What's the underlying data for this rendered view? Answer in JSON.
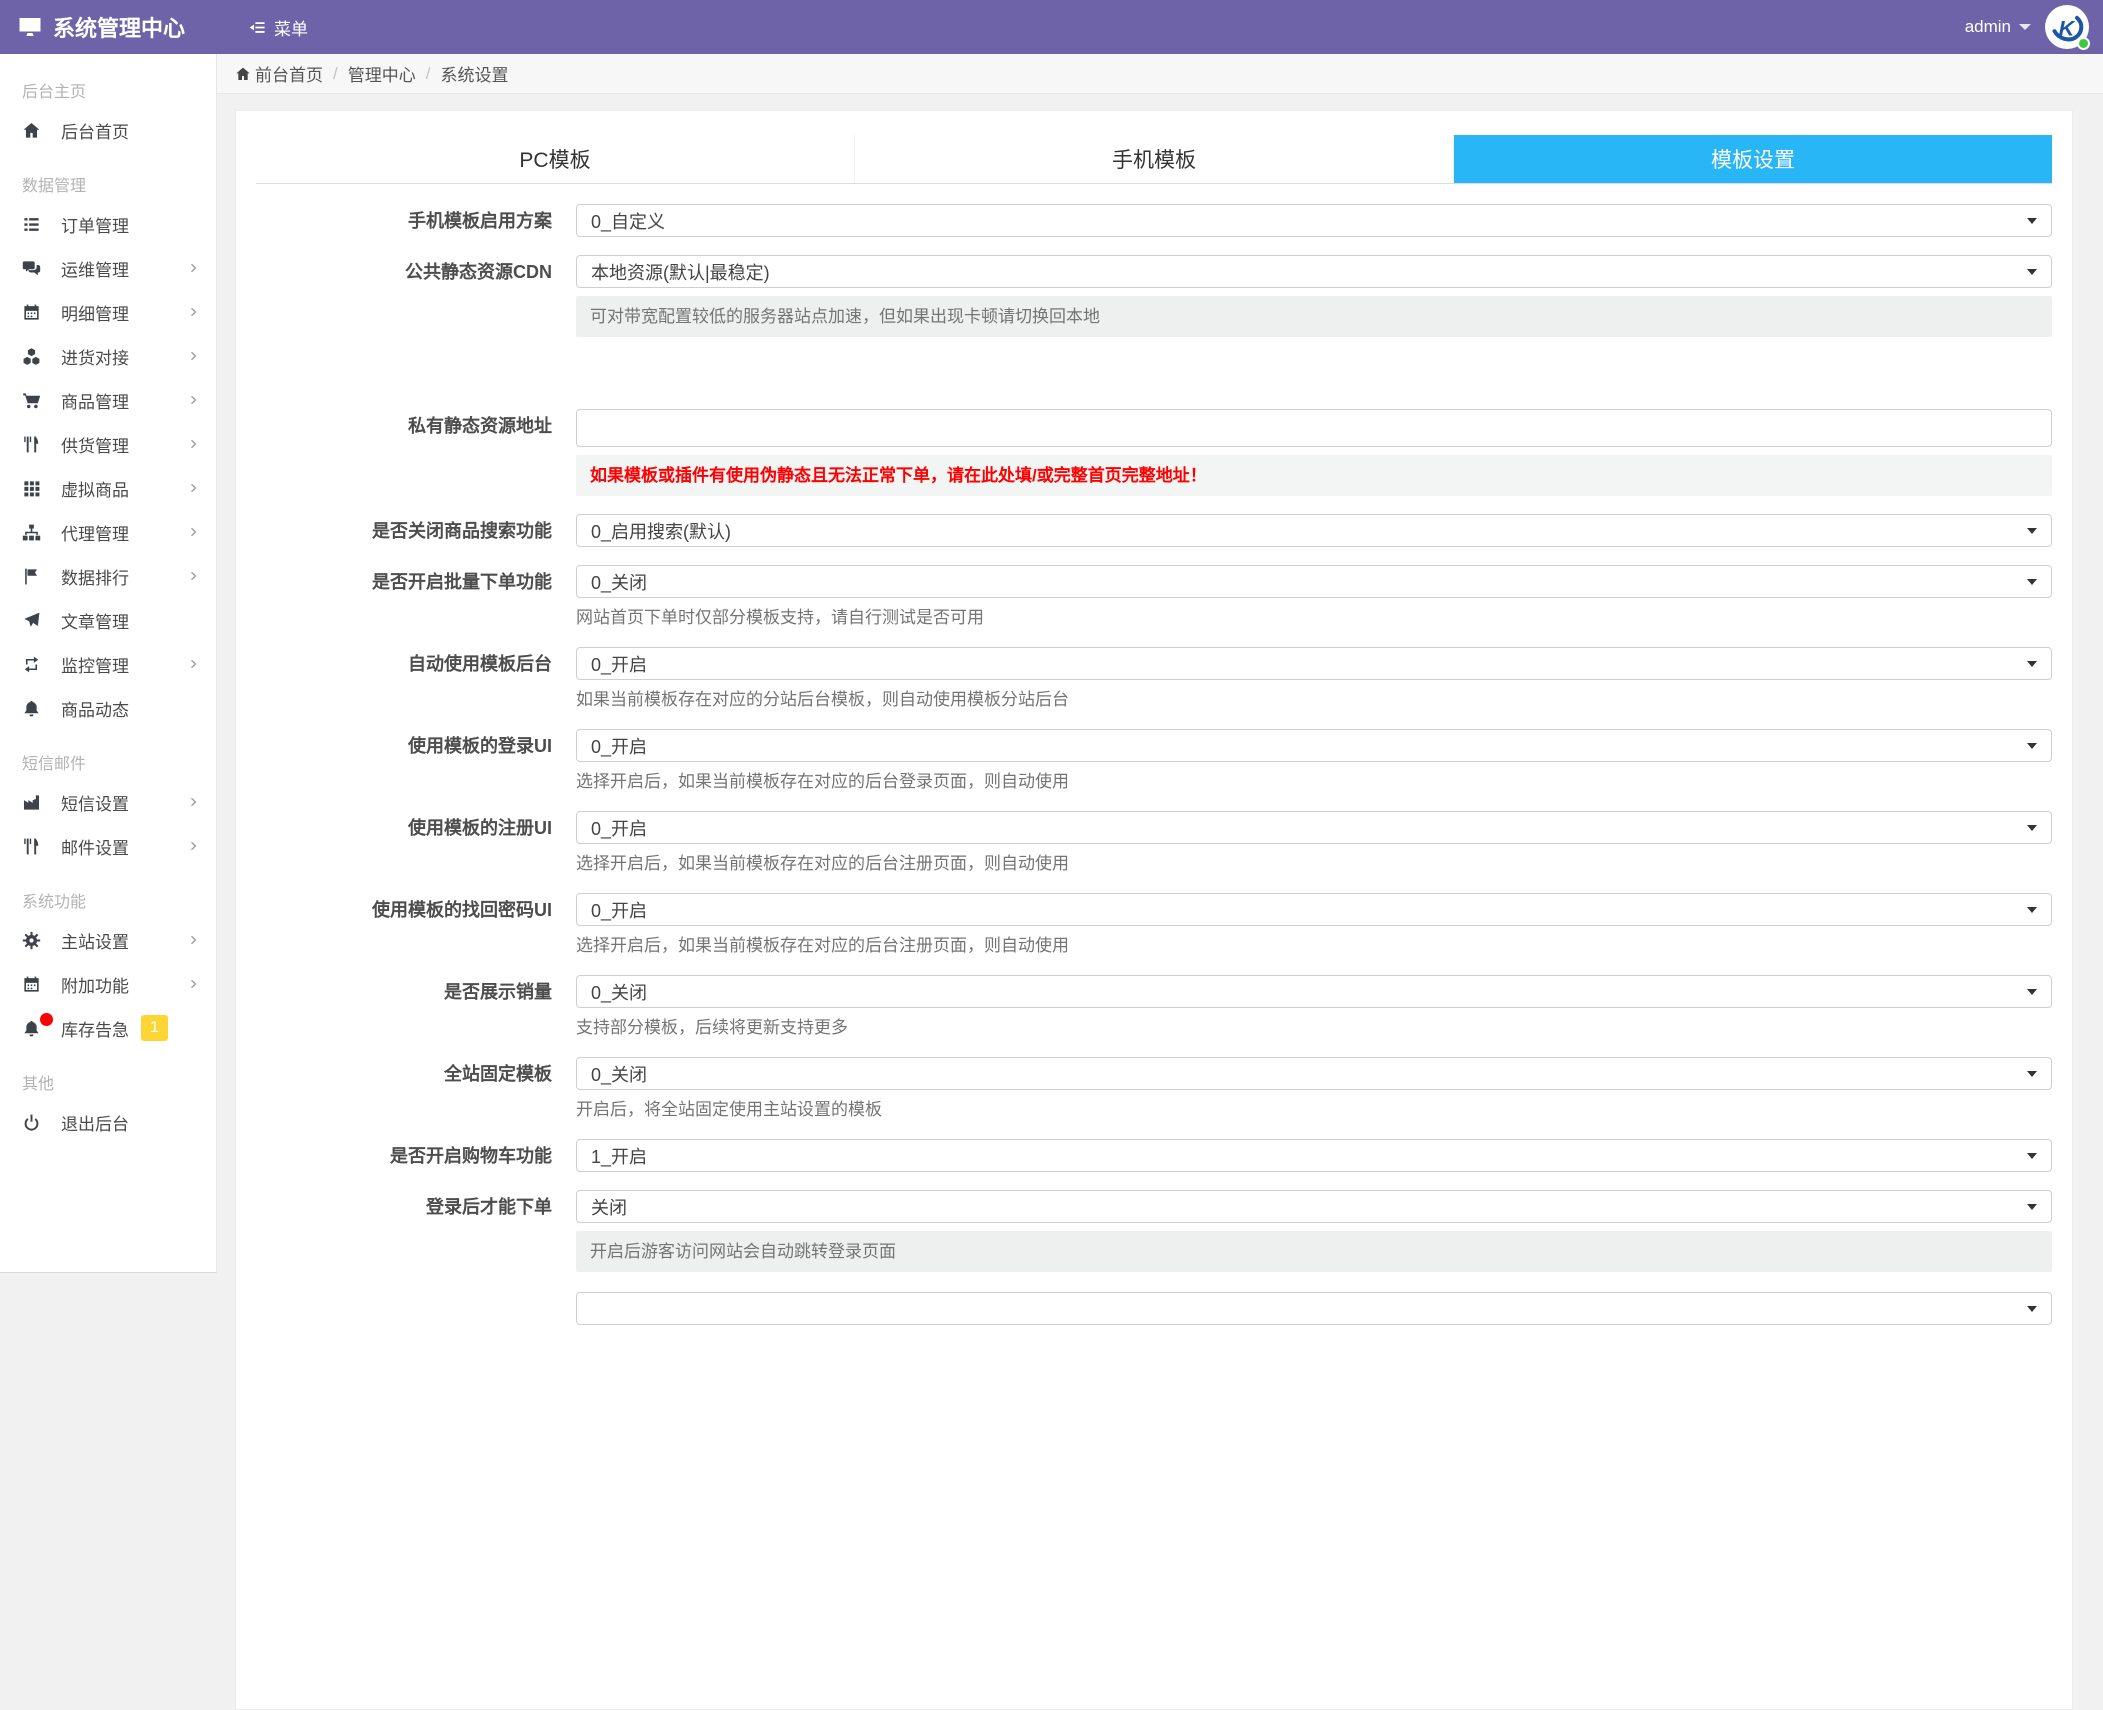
{
  "colors": {
    "navbar": "#6e63a8",
    "accent": "#29b6f6",
    "badge_yellow": "#fdd535",
    "alert_red": "#ff0000",
    "status_green": "#3ec93e"
  },
  "header": {
    "brand": "系统管理中心",
    "menu_label": "菜单",
    "user": "admin"
  },
  "breadcrumb": {
    "items": [
      "前台首页",
      "管理中心",
      "系统设置"
    ]
  },
  "sidebar": {
    "sections": [
      {
        "title": "后台主页",
        "items": [
          {
            "label": "后台首页",
            "icon": "home",
            "arrow": false
          }
        ]
      },
      {
        "title": "数据管理",
        "items": [
          {
            "label": "订单管理",
            "icon": "list",
            "arrow": false
          },
          {
            "label": "运维管理",
            "icon": "comments",
            "arrow": true
          },
          {
            "label": "明细管理",
            "icon": "calendar",
            "arrow": true
          },
          {
            "label": "进货对接",
            "icon": "cubes",
            "arrow": true
          },
          {
            "label": "商品管理",
            "icon": "cart",
            "arrow": true
          },
          {
            "label": "供货管理",
            "icon": "cutlery",
            "arrow": true
          },
          {
            "label": "虚拟商品",
            "icon": "grid",
            "arrow": true
          },
          {
            "label": "代理管理",
            "icon": "sitemap",
            "arrow": true
          },
          {
            "label": "数据排行",
            "icon": "flag",
            "arrow": true
          },
          {
            "label": "文章管理",
            "icon": "paper-plane",
            "arrow": false
          },
          {
            "label": "监控管理",
            "icon": "retweet",
            "arrow": true
          },
          {
            "label": "商品动态",
            "icon": "bell",
            "arrow": false
          }
        ]
      },
      {
        "title": "短信邮件",
        "items": [
          {
            "label": "短信设置",
            "icon": "factory",
            "arrow": true
          },
          {
            "label": "邮件设置",
            "icon": "cutlery",
            "arrow": true
          }
        ]
      },
      {
        "title": "系统功能",
        "items": [
          {
            "label": "主站设置",
            "icon": "gear",
            "arrow": true
          },
          {
            "label": "附加功能",
            "icon": "calendar",
            "arrow": true
          },
          {
            "label": "库存告急",
            "icon": "bell",
            "arrow": false,
            "dot": true,
            "badge": "1"
          }
        ]
      },
      {
        "title": "其他",
        "items": [
          {
            "label": "退出后台",
            "icon": "power",
            "arrow": false
          }
        ]
      }
    ]
  },
  "tabs": [
    {
      "label": "PC模板",
      "active": false
    },
    {
      "label": "手机模板",
      "active": false
    },
    {
      "label": "模板设置",
      "active": true
    }
  ],
  "form": {
    "rows": [
      {
        "label": "手机模板启用方案",
        "control": "select",
        "value": "0_自定义"
      },
      {
        "label": "公共静态资源CDN",
        "control": "select",
        "value": "本地资源(默认|最稳定)",
        "help": "可对带宽配置较低的服务器站点加速，但如果出现卡顿请切换回本地",
        "help_variant": "box",
        "gap_after": 72
      },
      {
        "label": "私有静态资源地址",
        "control": "input",
        "value": "",
        "help": "如果模板或插件有使用伪静态且无法正常下单，请在此处填/或完整首页完整地址！",
        "help_variant": "error"
      },
      {
        "label": "是否关闭商品搜索功能",
        "control": "select",
        "value": "0_启用搜索(默认)"
      },
      {
        "label": "是否开启批量下单功能",
        "control": "select",
        "value": "0_关闭",
        "help": "网站首页下单时仅部分模板支持，请自行测试是否可用",
        "help_variant": "plain"
      },
      {
        "label": "自动使用模板后台",
        "control": "select",
        "value": "0_开启",
        "help": "如果当前模板存在对应的分站后台模板，则自动使用模板分站后台",
        "help_variant": "plain"
      },
      {
        "label": "使用模板的登录UI",
        "control": "select",
        "value": "0_开启",
        "help": "选择开启后，如果当前模板存在对应的后台登录页面，则自动使用",
        "help_variant": "plain"
      },
      {
        "label": "使用模板的注册UI",
        "control": "select",
        "value": "0_开启",
        "help": "选择开启后，如果当前模板存在对应的后台注册页面，则自动使用",
        "help_variant": "plain"
      },
      {
        "label": "使用模板的找回密码UI",
        "control": "select",
        "value": "0_开启",
        "help": "选择开启后，如果当前模板存在对应的后台注册页面，则自动使用",
        "help_variant": "plain"
      },
      {
        "label": "是否展示销量",
        "control": "select",
        "value": "0_关闭",
        "help": "支持部分模板，后续将更新支持更多",
        "help_variant": "plain"
      },
      {
        "label": "全站固定模板",
        "control": "select",
        "value": "0_关闭",
        "help": "开启后，将全站固定使用主站设置的模板",
        "help_variant": "plain"
      },
      {
        "label": "是否开启购物车功能",
        "control": "select",
        "value": "1_开启"
      },
      {
        "label": "登录后才能下单",
        "control": "select",
        "value": "关闭",
        "help": "开启后游客访问网站会自动跳转登录页面",
        "help_variant": "box",
        "gap_after": 20
      },
      {
        "label": "",
        "control": "select",
        "value": ""
      }
    ]
  }
}
